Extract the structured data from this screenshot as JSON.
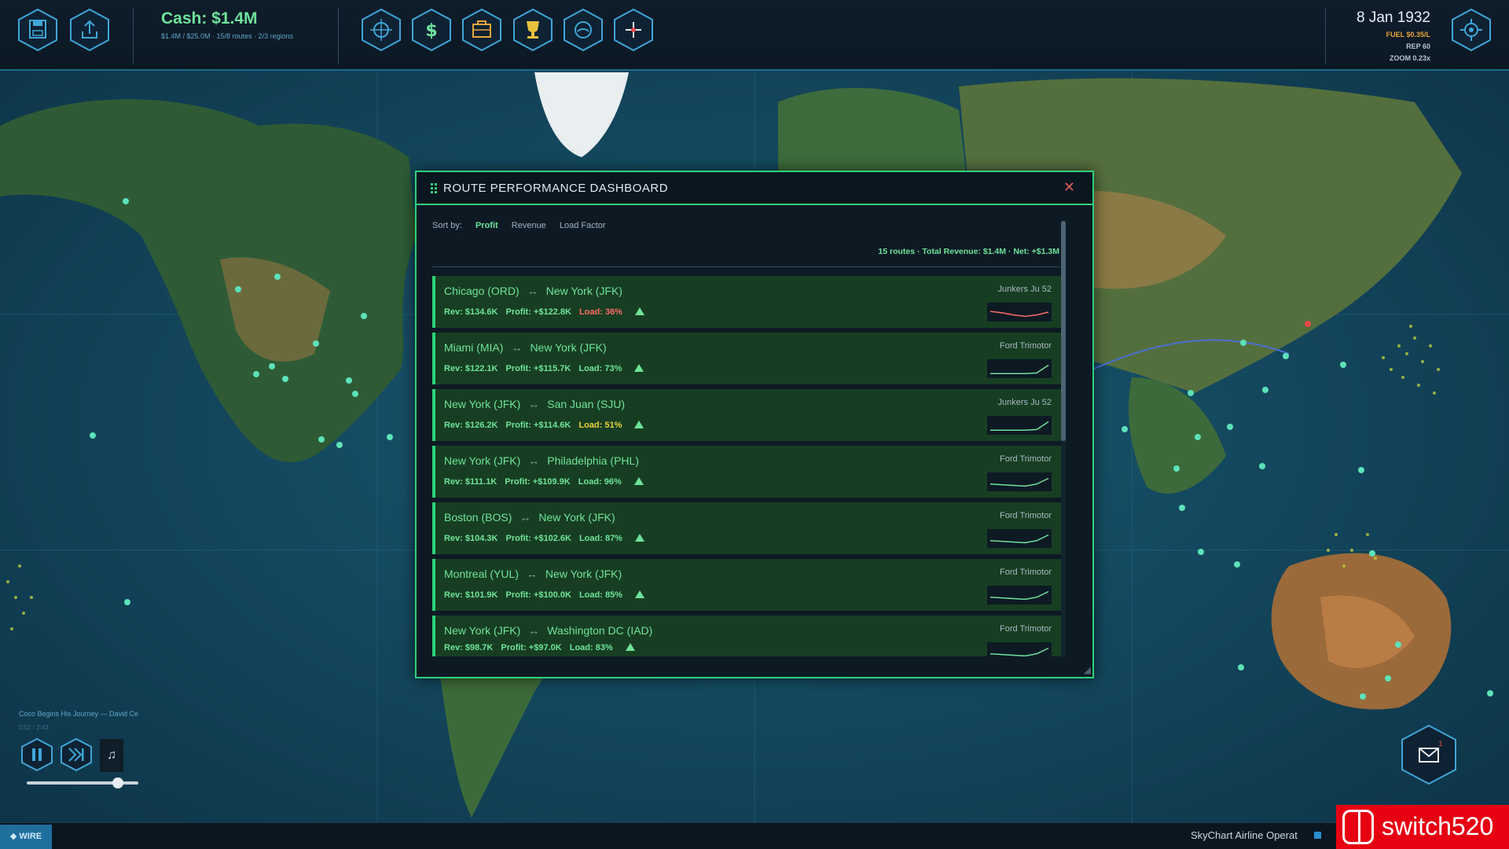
{
  "topbar": {
    "cash_label": "Cash: $1.4M",
    "cash_sub": "$1.4M / $25.0M  ·  15/8 routes  ·  2/3 regions",
    "date": "8 Jan 1932",
    "fuel": "FUEL $0.35/L",
    "rep": "REP 60",
    "zoom": "ZOOM 0.23x",
    "left_buttons": [
      {
        "icon": "save-icon"
      },
      {
        "icon": "export-icon"
      }
    ],
    "tool_buttons": [
      {
        "icon": "target-icon"
      },
      {
        "icon": "dollar-icon"
      },
      {
        "icon": "briefcase-icon"
      },
      {
        "icon": "trophy-icon"
      },
      {
        "icon": "gauge-icon"
      },
      {
        "icon": "crosshair-plus-icon"
      }
    ],
    "right_button": {
      "icon": "settings-target-icon"
    }
  },
  "dashboard": {
    "title": "ROUTE PERFORMANCE DASHBOARD",
    "sort_label": "Sort by:",
    "sort_options": [
      "Profit",
      "Revenue",
      "Load Factor"
    ],
    "sort_active": "Profit",
    "summary": "15 routes  ·  Total Revenue: $1.4M  ·  Net: +$1.3M",
    "routes": [
      {
        "from": "Chicago (ORD)",
        "to": "New York (JFK)",
        "aircraft": "Junkers Ju 52",
        "rev": "Rev: $134.6K",
        "profit": "Profit: +$122.8K",
        "load": "Load: 36%",
        "load_color": "#ff6b6b",
        "trend": "up",
        "spark": [
          0.55,
          0.45,
          0.3,
          0.2,
          0.3,
          0.5
        ],
        "spark_color": "#ff6b6b"
      },
      {
        "from": "Miami (MIA)",
        "to": "New York (JFK)",
        "aircraft": "Ford Trimotor",
        "rev": "Rev: $122.1K",
        "profit": "Profit: +$115.7K",
        "load": "Load: 73%",
        "load_color": "#6fe39b",
        "trend": "up",
        "spark": [
          0.15,
          0.15,
          0.15,
          0.15,
          0.2,
          0.75
        ],
        "spark_color": "#6fe39b"
      },
      {
        "from": "New York (JFK)",
        "to": "San Juan (SJU)",
        "aircraft": "Junkers Ju 52",
        "rev": "Rev: $126.2K",
        "profit": "Profit: +$114.6K",
        "load": "Load: 51%",
        "load_color": "#e8d23c",
        "trend": "up",
        "spark": [
          0.15,
          0.15,
          0.15,
          0.15,
          0.2,
          0.75
        ],
        "spark_color": "#6fe39b"
      },
      {
        "from": "New York (JFK)",
        "to": "Philadelphia (PHL)",
        "aircraft": "Ford Trimotor",
        "rev": "Rev: $111.1K",
        "profit": "Profit: +$109.9K",
        "load": "Load: 96%",
        "load_color": "#6fe39b",
        "trend": "up",
        "spark": [
          0.35,
          0.3,
          0.25,
          0.2,
          0.35,
          0.75
        ],
        "spark_color": "#6fe39b"
      },
      {
        "from": "Boston (BOS)",
        "to": "New York (JFK)",
        "aircraft": "Ford Trimotor",
        "rev": "Rev: $104.3K",
        "profit": "Profit: +$102.6K",
        "load": "Load: 87%",
        "load_color": "#6fe39b",
        "trend": "up",
        "spark": [
          0.35,
          0.3,
          0.25,
          0.2,
          0.35,
          0.75
        ],
        "spark_color": "#6fe39b"
      },
      {
        "from": "Montreal (YUL)",
        "to": "New York (JFK)",
        "aircraft": "Ford Trimotor",
        "rev": "Rev: $101.9K",
        "profit": "Profit: +$100.0K",
        "load": "Load: 85%",
        "load_color": "#6fe39b",
        "trend": "up",
        "spark": [
          0.35,
          0.3,
          0.25,
          0.2,
          0.35,
          0.75
        ],
        "spark_color": "#6fe39b"
      },
      {
        "from": "New York (JFK)",
        "to": "Washington DC (IAD)",
        "aircraft": "Ford Trimotor",
        "rev": "Rev: $98.7K",
        "profit": "Profit: +$97.0K",
        "load": "Load: 83%",
        "load_color": "#6fe39b",
        "trend": "up",
        "spark": [
          0.35,
          0.3,
          0.25,
          0.2,
          0.35,
          0.75
        ],
        "spark_color": "#6fe39b"
      }
    ]
  },
  "music": {
    "track": "Coco Begins His Journey  —  David Ce",
    "time": "0:02 / 2:43",
    "buttons": [
      {
        "icon": "pause-icon"
      },
      {
        "icon": "skip-forward-icon"
      }
    ],
    "note_icon": "music-note-icon",
    "volume": 0.82
  },
  "bottombar": {
    "wire_label": "WIRE",
    "app_name": "SkyChart Airline Operat"
  },
  "mail": {
    "icon": "mail-icon",
    "badge": "1"
  },
  "watermark": {
    "text": "switch520",
    "logo": "switch-logo"
  },
  "colors": {
    "accent_green": "#2fd17a",
    "text_green": "#6fe39b",
    "bad_red": "#ff6b6b",
    "warn_yellow": "#e8d23c",
    "fuel_orange": "#e8a53c",
    "hex_blue": "#3fa6d8"
  }
}
